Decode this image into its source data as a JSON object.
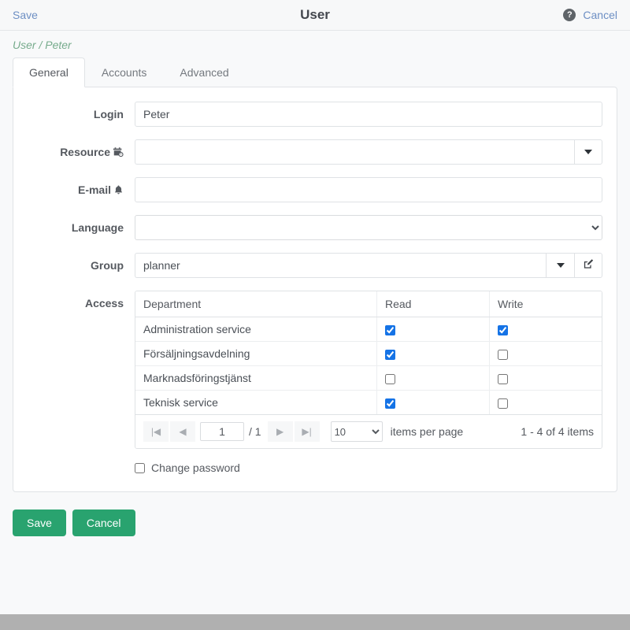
{
  "topbar": {
    "save_label": "Save",
    "title": "User",
    "cancel_label": "Cancel",
    "help_glyph": "?"
  },
  "breadcrumb": "User / Peter",
  "tabs": [
    {
      "label": "General",
      "active": true
    },
    {
      "label": "Accounts",
      "active": false
    },
    {
      "label": "Advanced",
      "active": false
    }
  ],
  "form": {
    "login": {
      "label": "Login",
      "value": "Peter",
      "placeholder": ""
    },
    "resource": {
      "label": "Resource",
      "value": "",
      "placeholder": "",
      "icon": "resource-icon"
    },
    "email": {
      "label": "E-mail",
      "value": "",
      "placeholder": "",
      "icon": "bell-icon"
    },
    "language": {
      "label": "Language",
      "value": "",
      "options": [
        ""
      ]
    },
    "group": {
      "label": "Group",
      "value": "planner",
      "placeholder": ""
    },
    "access": {
      "label": "Access"
    }
  },
  "access_table": {
    "columns": [
      "Department",
      "Read",
      "Write"
    ],
    "rows": [
      {
        "department": "Administration service",
        "read": true,
        "write": true
      },
      {
        "department": "Försäljningsavdelning",
        "read": true,
        "write": false
      },
      {
        "department": "Marknadsföringstjänst",
        "read": false,
        "write": false
      },
      {
        "department": "Teknisk service",
        "read": true,
        "write": false
      }
    ]
  },
  "pager": {
    "first_glyph": "|◀",
    "prev_glyph": "◀",
    "page_value": "1",
    "page_total": "/ 1",
    "next_glyph": "▶",
    "last_glyph": "▶|",
    "page_size": "10",
    "page_size_options": [
      "10"
    ],
    "items_per_page_label": "items per page",
    "summary": "1 - 4 of 4 items"
  },
  "change_password": {
    "label": "Change password",
    "checked": false
  },
  "actions": {
    "save_label": "Save",
    "cancel_label": "Cancel"
  },
  "colors": {
    "accent_green": "#29a36f",
    "link_blue": "#6d8fc4",
    "breadcrumb_green": "#76ab8c",
    "checkbox_blue": "#1573e6",
    "footer_gray": "#b0b0b0"
  }
}
